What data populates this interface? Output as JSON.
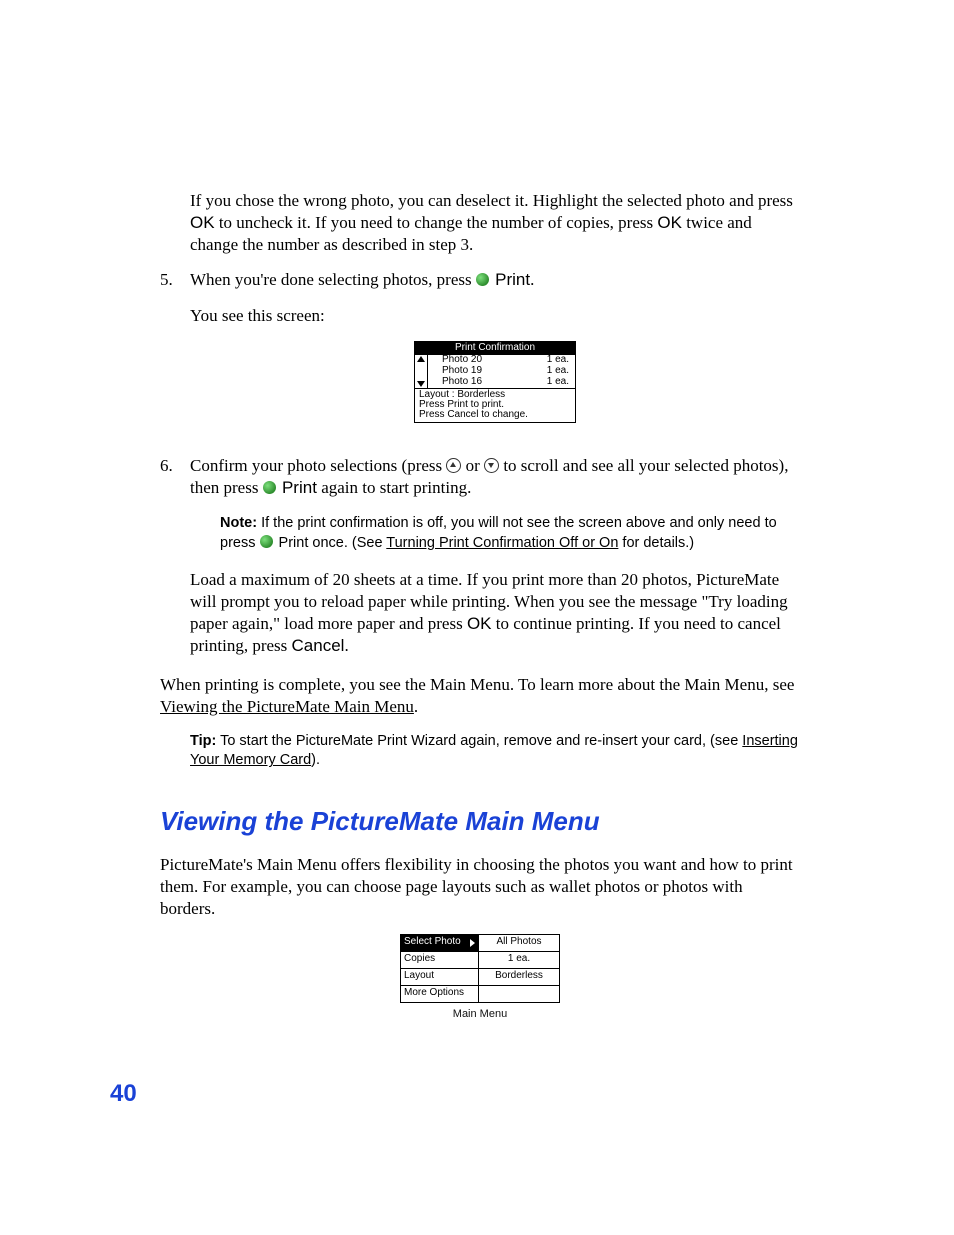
{
  "page_number": "40",
  "intro_para": {
    "t1": "If you chose the wrong photo, you can deselect it. Highlight the selected photo and press ",
    "ok1": "OK",
    "t2": " to uncheck it. If you need to change the number of copies, press ",
    "ok2": "OK",
    "t3": " twice and change the number as described in step 3."
  },
  "step5": {
    "num": "5.",
    "t1": "When you're done selecting photos, press ",
    "print": "Print",
    "t2": ".",
    "sub": "You see this screen:"
  },
  "lcd_confirm": {
    "title": "Print Confirmation",
    "rows": [
      {
        "name": "Photo 20",
        "qty": "1 ea."
      },
      {
        "name": "Photo 19",
        "qty": "1 ea."
      },
      {
        "name": "Photo 16",
        "qty": "1 ea."
      }
    ],
    "footer": [
      "Layout : Borderless",
      "Press Print to print.",
      "Press Cancel to change."
    ]
  },
  "step6": {
    "num": "6.",
    "t1": "Confirm your photo selections (press ",
    "t2": " or ",
    "t3": " to scroll and see all your selected photos), then press ",
    "print": "Print",
    "t4": " again to start printing."
  },
  "note": {
    "label": "Note:",
    "t1": " If the print confirmation is off, you will not see the screen above and only need to press ",
    "print": "Print",
    "t2": " once. (See ",
    "link": "Turning Print Confirmation Off or On",
    "t3": " for details.)"
  },
  "load_para": {
    "t1": "Load a maximum of 20 sheets at a time. If you print more than 20 photos, PictureMate will prompt you to reload paper while printing. When you see the message \"Try loading paper again,\" load more paper and press ",
    "ok": "OK",
    "t2": " to continue printing. If you need to cancel printing, press ",
    "cancel": "Cancel",
    "t3": "."
  },
  "complete_para": {
    "t1": "When printing is complete, you see the Main Menu. To learn more about the Main Menu, see ",
    "link": "Viewing the PictureMate Main Menu",
    "t2": "."
  },
  "tip": {
    "label": "Tip:",
    "t1": " To start the PictureMate Print Wizard again, remove and re-insert your card, (see ",
    "link": "Inserting Your Memory Card",
    "t2": ")."
  },
  "heading": "Viewing the PictureMate Main Menu",
  "heading_para": "PictureMate's Main Menu offers flexibility in choosing the photos you want and how to print them. For example, you can choose page layouts such as wallet photos or photos with borders.",
  "lcd_menu": {
    "rows": [
      {
        "left": "Select Photo",
        "right": "All Photos",
        "selected": true
      },
      {
        "left": "Copies",
        "right": "1 ea."
      },
      {
        "left": "Layout",
        "right": "Borderless"
      },
      {
        "left": "More Options",
        "right": ""
      }
    ],
    "caption": "Main Menu"
  }
}
